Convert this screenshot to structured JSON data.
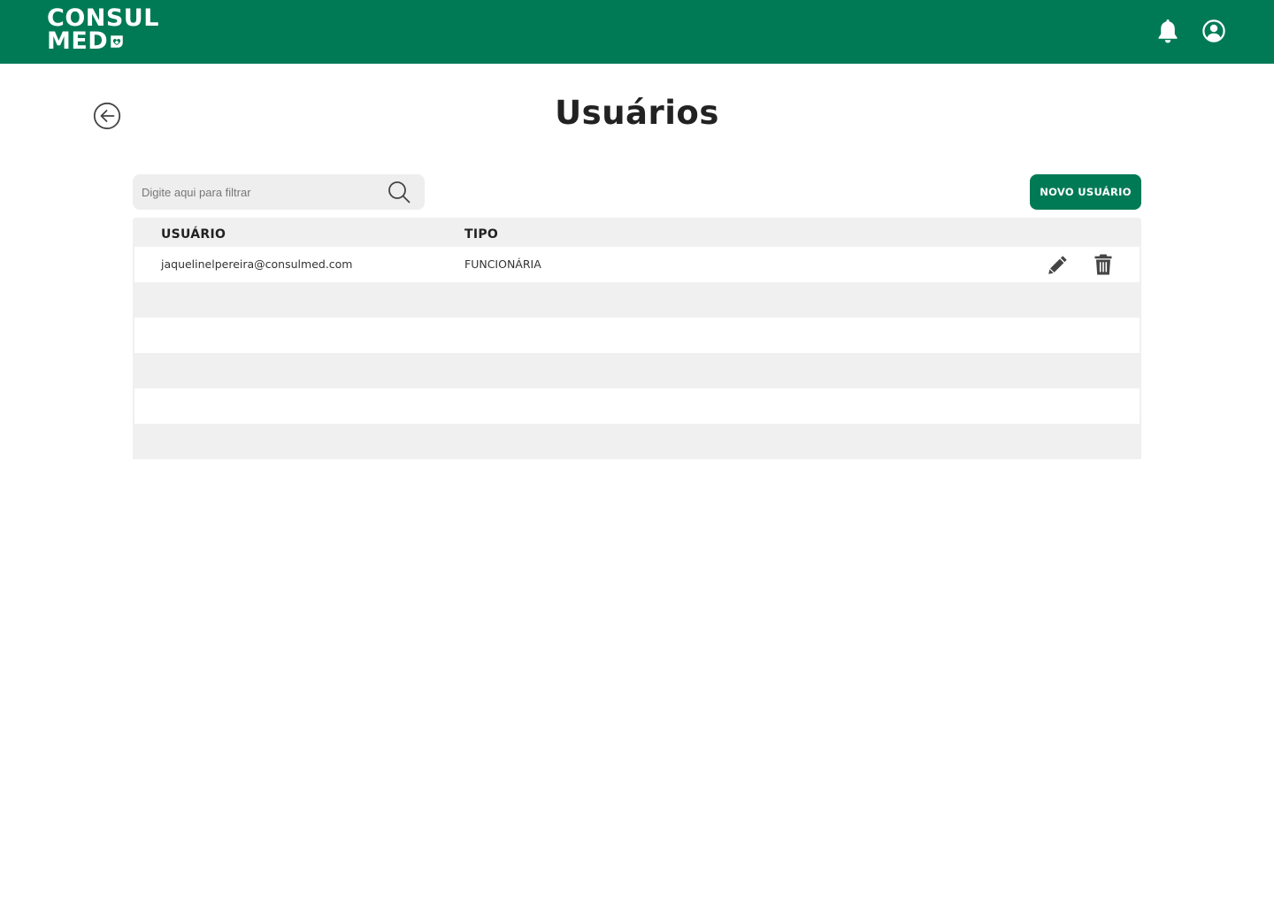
{
  "header": {
    "logo": {
      "line1": "CONSUL",
      "line2": "MED"
    },
    "icons": {
      "notifications": "bell-icon",
      "account": "user-circle-icon"
    },
    "brand_color": "#007A55"
  },
  "page": {
    "title": "Usuários",
    "back_icon": "arrow-left-circle-icon"
  },
  "search": {
    "placeholder": "Digite aqui para filtrar",
    "value": "",
    "icon": "search-icon"
  },
  "actions": {
    "new_user_label": "NOVO USUÁRIO"
  },
  "table": {
    "columns": [
      "USUÁRIO",
      "TIPO"
    ],
    "rows": [
      {
        "usuario": "jaquelinelpereira@consulmed.com",
        "tipo": "FUNCIONÁRIA",
        "row_icons": [
          "edit-icon",
          "trash-icon"
        ]
      }
    ]
  }
}
